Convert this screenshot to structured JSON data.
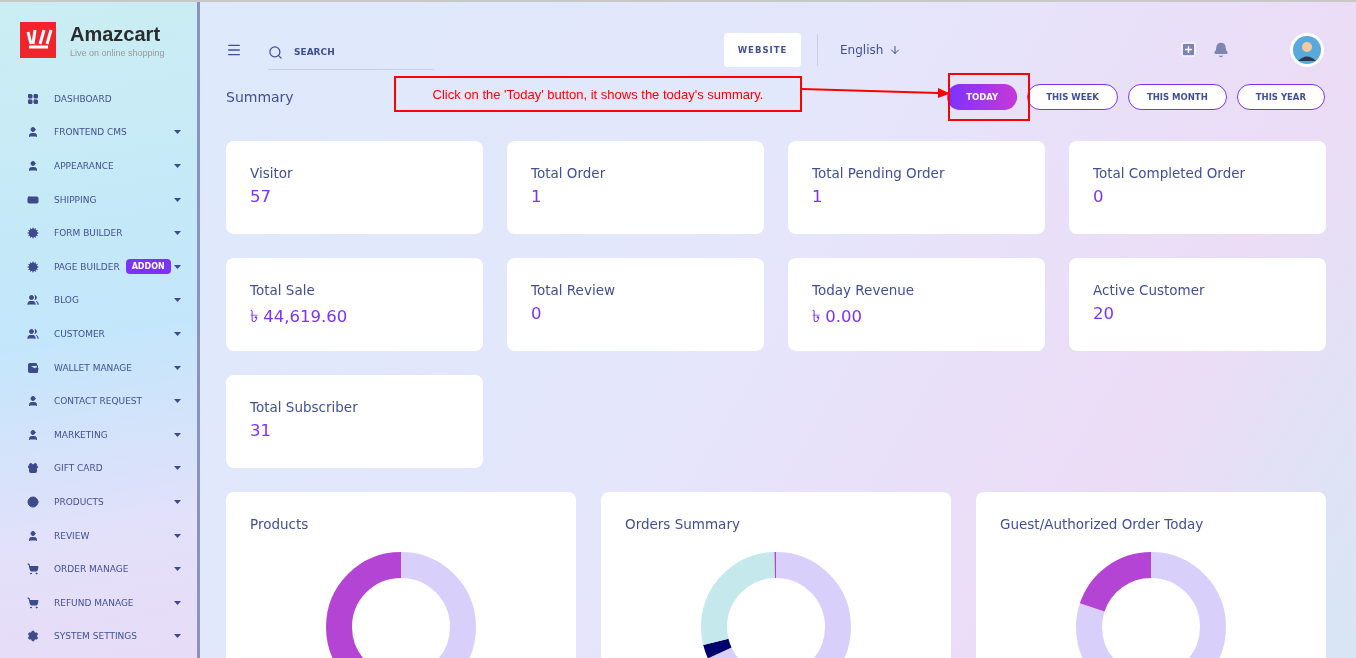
{
  "brand": {
    "name": "Amazcart",
    "tagline": "Live on online shopping"
  },
  "sidebar": {
    "items": [
      {
        "label": "DASHBOARD",
        "kind": "link"
      },
      {
        "label": "FRONTEND CMS",
        "kind": "menu"
      },
      {
        "label": "APPEARANCE",
        "kind": "menu"
      },
      {
        "label": "SHIPPING",
        "kind": "menu"
      },
      {
        "label": "FORM BUILDER",
        "kind": "menu"
      },
      {
        "label": "PAGE BUILDER",
        "kind": "menu",
        "badge": "ADDON"
      },
      {
        "label": "BLOG",
        "kind": "menu"
      },
      {
        "label": "CUSTOMER",
        "kind": "menu"
      },
      {
        "label": "WALLET MANAGE",
        "kind": "menu"
      },
      {
        "label": "CONTACT REQUEST",
        "kind": "menu"
      },
      {
        "label": "MARKETING",
        "kind": "menu"
      },
      {
        "label": "GIFT CARD",
        "kind": "menu"
      },
      {
        "label": "PRODUCTS",
        "kind": "menu"
      },
      {
        "label": "REVIEW",
        "kind": "menu"
      },
      {
        "label": "ORDER MANAGE",
        "kind": "menu"
      },
      {
        "label": "REFUND MANAGE",
        "kind": "menu"
      },
      {
        "label": "SYSTEM SETTINGS",
        "kind": "menu"
      }
    ]
  },
  "header": {
    "search": {
      "placeholder": "SEARCH"
    },
    "website_button": "WEBSITE",
    "language": "English"
  },
  "summary": {
    "title": "Summary",
    "periods": [
      {
        "label": "TODAY",
        "selected": true
      },
      {
        "label": "THIS WEEK",
        "selected": false
      },
      {
        "label": "THIS MONTH",
        "selected": false
      },
      {
        "label": "THIS YEAR",
        "selected": false
      }
    ]
  },
  "annotation": {
    "text": "Click on the 'Today' button, it shows the today's summary."
  },
  "stats": [
    {
      "label": "Visitor",
      "value": "57"
    },
    {
      "label": "Total Order",
      "value": "1"
    },
    {
      "label": "Total Pending Order",
      "value": "1"
    },
    {
      "label": "Total Completed Order",
      "value": "0"
    },
    {
      "label": "Total Sale",
      "value": "৳ 44,619.60"
    },
    {
      "label": "Total Review",
      "value": "0"
    },
    {
      "label": "Today Revenue",
      "value": "৳ 0.00"
    },
    {
      "label": "Active Customer",
      "value": "20"
    },
    {
      "label": "Total Subscriber",
      "value": "31"
    }
  ],
  "charts": [
    {
      "title": "Products"
    },
    {
      "title": "Orders Summary"
    },
    {
      "title": "Guest/Authorized Order Today"
    }
  ]
}
